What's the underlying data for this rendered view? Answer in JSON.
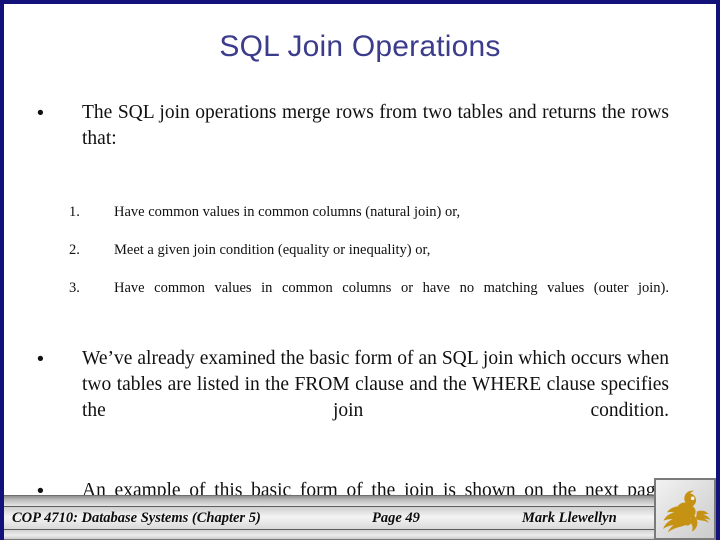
{
  "slide": {
    "title": "SQL Join Operations",
    "title_color": "#3c3c8c",
    "border_color": "#12127a",
    "background": "#ffffff"
  },
  "bullets": [
    {
      "marker": "•",
      "level": 1,
      "text": "The SQL join operations merge rows from two tables and returns the rows that:"
    },
    {
      "marker": "1.",
      "level": 2,
      "text": "Have common values in common columns (natural join) or,"
    },
    {
      "marker": "2.",
      "level": 2,
      "text": "Meet a given join condition (equality or inequality) or,"
    },
    {
      "marker": "3.",
      "level": 2,
      "text": "Have common values in common columns or have no matching values (outer join)."
    },
    {
      "marker": "•",
      "level": 1,
      "text": "We’ve already examined the basic form of an SQL join which occurs when two tables are listed in the FROM clause and the WHERE clause specifies the join condition."
    },
    {
      "marker": "•",
      "level": 1,
      "text": "An example of this basic form of the join is shown on the next page."
    }
  ],
  "footer": {
    "course": "COP 4710: Database Systems  (Chapter 5)",
    "page": "Page 49",
    "author": "Mark Llewellyn",
    "logo": "pegasus-logo",
    "logo_color": "#c69214"
  }
}
